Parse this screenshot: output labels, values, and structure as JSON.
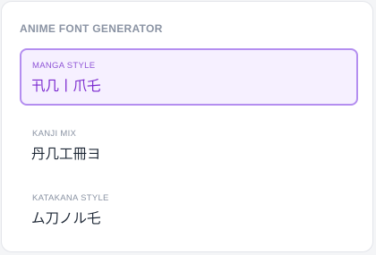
{
  "panel": {
    "title": "ANIME FONT GENERATOR"
  },
  "options": [
    {
      "label": "MANGA STYLE",
      "sample": "卂几丨爪乇",
      "selected": true
    },
    {
      "label": "KANJI MIX",
      "sample": "丹几工冊ヨ",
      "selected": false
    },
    {
      "label": "KATAKANA STYLE",
      "sample": "ム刀ノル乇",
      "selected": false
    }
  ],
  "colors": {
    "accent_border": "#b48ef0",
    "accent_background": "#f6f0ff",
    "accent_text": "#7a28cf",
    "label_text": "#8a93a3",
    "sample_text": "#1f2937"
  }
}
